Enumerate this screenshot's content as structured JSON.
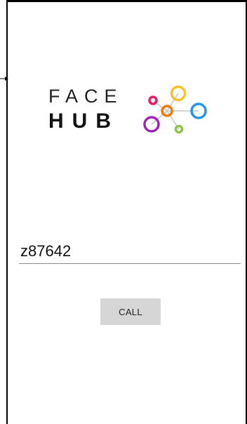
{
  "logo": {
    "line1": "FACE",
    "line2": "HUB",
    "mark_colors": [
      "#e91e63",
      "#fbc02d",
      "#f57c00",
      "#2196f3",
      "#9c27b0",
      "#8bc34a"
    ]
  },
  "call_form": {
    "input_value": "z87642",
    "button_label": "CALL"
  }
}
